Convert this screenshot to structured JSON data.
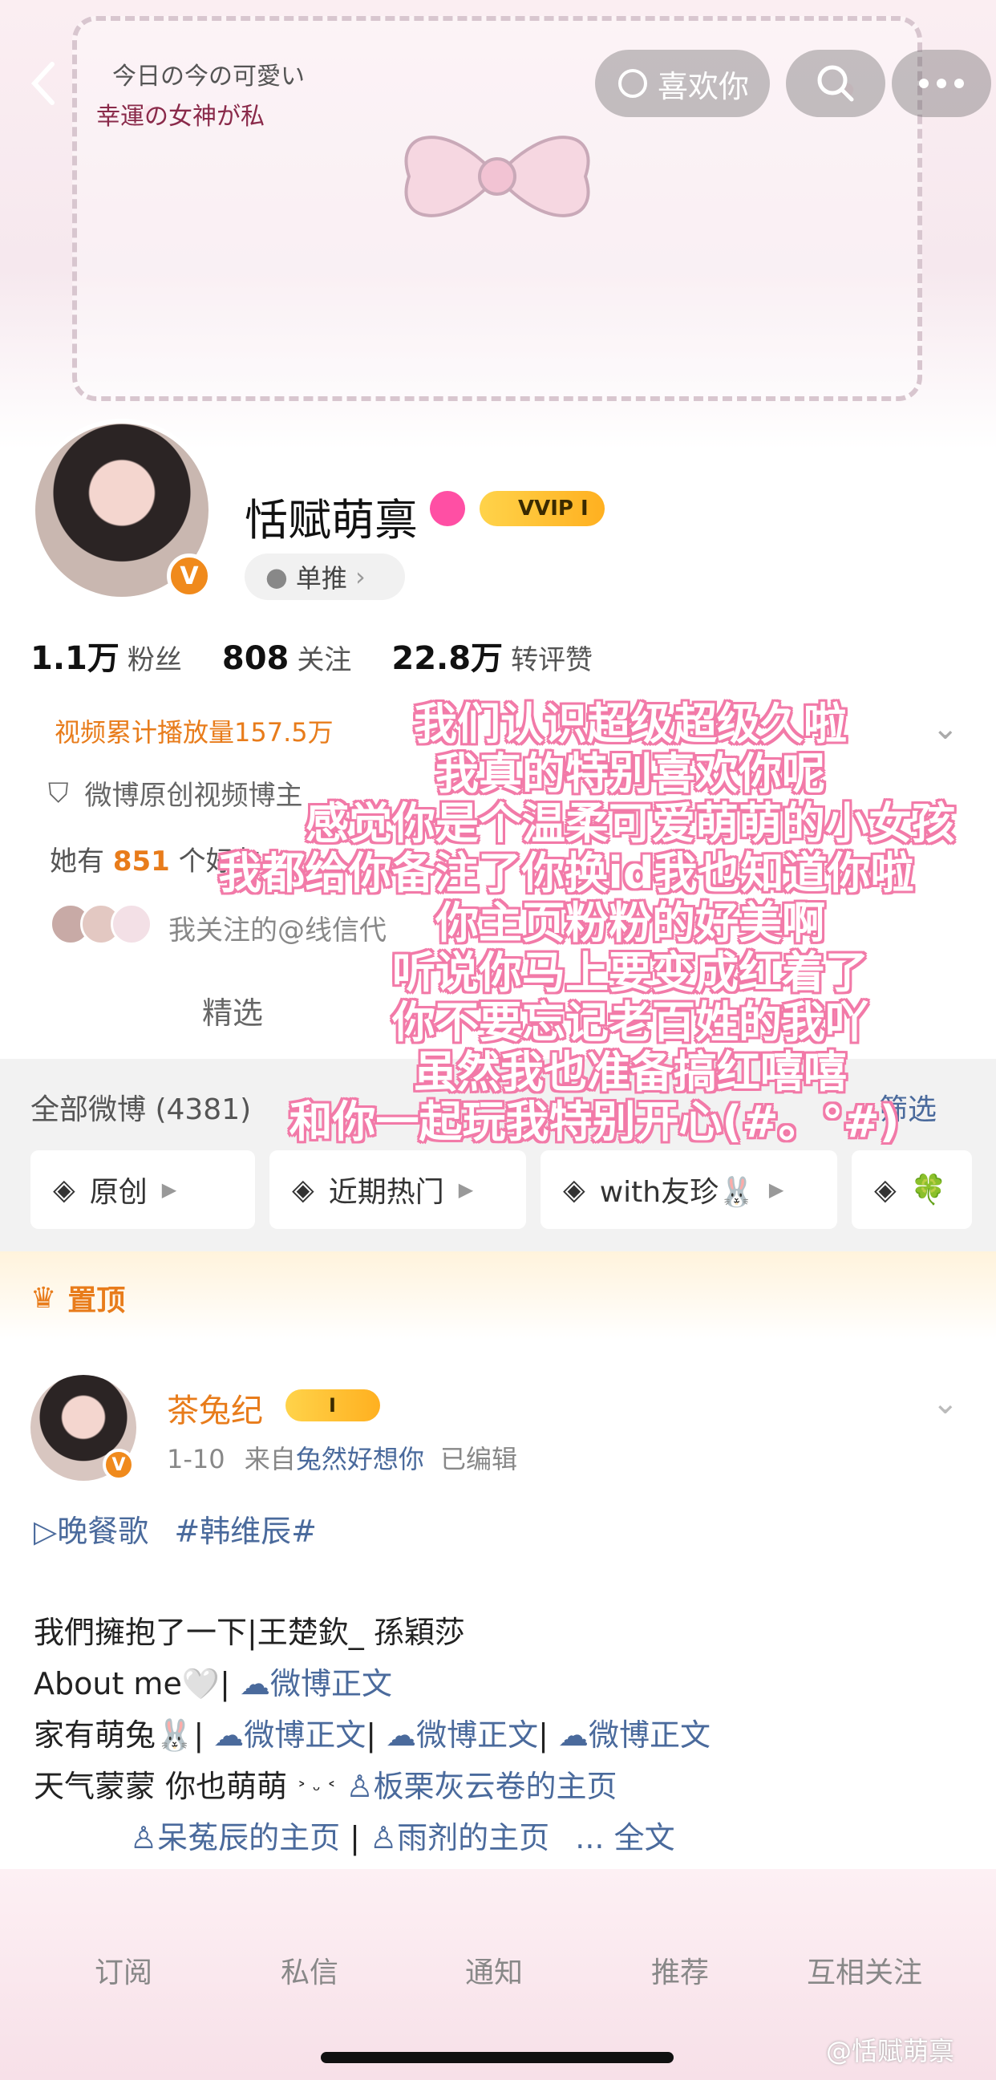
{
  "header": {
    "banner_line1": "今日の今の可愛い",
    "banner_line2": "幸運の女神が私",
    "like_label": "喜欢你"
  },
  "profile": {
    "name": "恬赋萌禀",
    "vip_label": "VVIP I",
    "recommend_label": "单推",
    "stats": [
      {
        "num": "1.1万",
        "label": "粉丝"
      },
      {
        "num": "808",
        "label": "关注"
      },
      {
        "num": "22.8万",
        "label": "转评赞"
      }
    ],
    "views_text": "视频累计播放量157.5万",
    "origin_text": "微博原创视频博主",
    "friends_prefix": "她有",
    "friends_count": "851",
    "friends_suffix": "个好友",
    "follow_text": "我关注的@线信代"
  },
  "tabs": {
    "selected": "精选"
  },
  "feed_header": {
    "all_weibo": "全部微博 (4381)",
    "filter": "筛选"
  },
  "chips": [
    {
      "label": "原创"
    },
    {
      "label": "近期热门"
    },
    {
      "label": "with友珍🐰"
    },
    {
      "label": "🍀"
    }
  ],
  "pinned_label": "置顶",
  "post": {
    "author": "茶兔纪",
    "rank": "I",
    "date": "1-10",
    "from_prefix": "来自",
    "source": "兔然好想你",
    "edited": "已编辑",
    "line1_song": "▷晚餐歌",
    "line1_tag": "#韩维辰#",
    "line2": "我們擁抱了一下|王楚欽_ 孫穎莎",
    "line3_text": "About me🤍|",
    "line3_link": "微博正文",
    "line4_text": "家有萌兔🐰|",
    "line4_link1": "微博正文",
    "line4_link2": "微博正文",
    "line4_link3": "微博正文",
    "line5_text": "天气蒙蒙 你也萌萌",
    "line5_small": "˃ ᵕ ˂",
    "line5_link": "板栗灰云卷的主页",
    "line6_link1": "呆菟辰的主页",
    "line6_link2": "雨剂的主页",
    "line6_more": "... 全文"
  },
  "overlay_lines": [
    "我们认识超级超级久啦",
    "我真的特别喜欢你呢",
    "感觉你是个温柔可爱萌萌的小女孩",
    "我都给你备注了你换id我也知道你啦",
    "你主页粉粉的好美啊",
    "听说你马上要变成红着了",
    "你不要忘记老百姓的我吖",
    "虽然我也准备搞红嘻嘻",
    "和你一起玩我特别开心(#。°#)"
  ],
  "bottom_nav": [
    {
      "label": "订阅"
    },
    {
      "label": "私信"
    },
    {
      "label": "通知"
    },
    {
      "label": "推荐"
    },
    {
      "label": "互相关注"
    }
  ],
  "watermark": "@恬赋萌禀",
  "colors": {
    "accent_orange": "#e87c1b",
    "link_blue": "#4a6a9c",
    "overlay_pink": "#f27aa8"
  }
}
